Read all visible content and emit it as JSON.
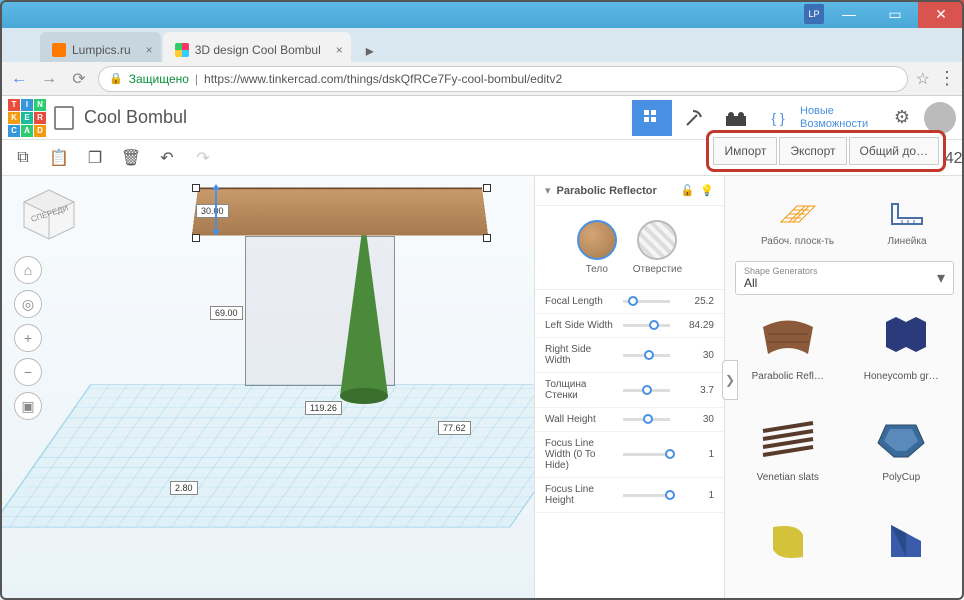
{
  "window": {
    "lp": "LP"
  },
  "tabs": {
    "t1": "Lumpics.ru",
    "t2": "3D design Cool Bombul"
  },
  "addr": {
    "secure": "Защищено",
    "url": "https://www.tinkercad.com/things/dskQfRCe7Fy-cool-bombul/editv2"
  },
  "header": {
    "title": "Cool Bombul",
    "news1": "Новые",
    "news2": "Возможности"
  },
  "impex": {
    "import": "Импорт",
    "export": "Экспорт",
    "share": "Общий до…"
  },
  "canvas": {
    "viewcube": "СПЕРЕДИ",
    "dims": {
      "h": "30.00",
      "d": "69.00",
      "w": "119.26",
      "w2": "77.62",
      "off": "2.80"
    }
  },
  "inspector": {
    "title": "Parabolic Reflector",
    "solid": "Тело",
    "hole": "Отверстие",
    "props": [
      {
        "lbl": "Focal Length",
        "val": "25.2",
        "pos": 10
      },
      {
        "lbl": "Left Side Width",
        "val": "84.29",
        "pos": 55
      },
      {
        "lbl": "Right Side Width",
        "val": "30",
        "pos": 45
      },
      {
        "lbl": "Толщина Стенки",
        "val": "3.7",
        "pos": 40
      },
      {
        "lbl": "Wall Height",
        "val": "30",
        "pos": 42
      },
      {
        "lbl": "Focus Line Width (0 To Hide)",
        "val": "1",
        "pos": 90
      },
      {
        "lbl": "Focus Line Height",
        "val": "1",
        "pos": 90
      }
    ]
  },
  "panel": {
    "workplane": "Рабоч. плоск-ть",
    "ruler": "Линейка",
    "catlabel": "Shape Generators",
    "catval": "All",
    "shapes": [
      {
        "name": "Parabolic Refl…"
      },
      {
        "name": "Honeycomb gr…"
      },
      {
        "name": "Venetian slats"
      },
      {
        "name": "PolyCup"
      },
      {
        "name": ""
      },
      {
        "name": ""
      }
    ]
  }
}
